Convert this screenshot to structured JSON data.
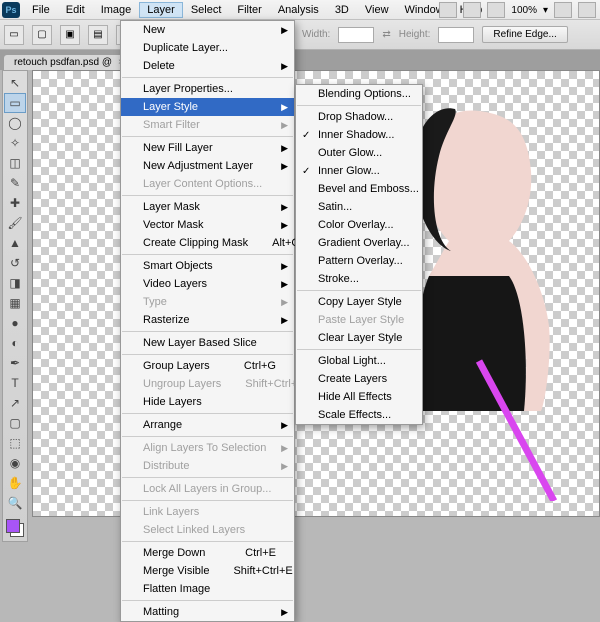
{
  "menubar": {
    "items": [
      "File",
      "Edit",
      "Image",
      "Layer",
      "Select",
      "Filter",
      "Analysis",
      "3D",
      "View",
      "Window",
      "Help"
    ],
    "activeIndex": 3
  },
  "topControls": {
    "zoom": "100%"
  },
  "optionsBar": {
    "widthLabel": "Width:",
    "heightLabel": "Height:",
    "refine": "Refine Edge..."
  },
  "tab": {
    "title": "retouch psdfan.psd @",
    "close": "×"
  },
  "layerMenu": [
    {
      "label": "New",
      "arrow": true
    },
    {
      "label": "Duplicate Layer..."
    },
    {
      "label": "Delete",
      "arrow": true
    },
    {
      "sep": true
    },
    {
      "label": "Layer Properties..."
    },
    {
      "label": "Layer Style",
      "arrow": true,
      "hl": true
    },
    {
      "label": "Smart Filter",
      "arrow": true,
      "disabled": true
    },
    {
      "sep": true
    },
    {
      "label": "New Fill Layer",
      "arrow": true
    },
    {
      "label": "New Adjustment Layer",
      "arrow": true
    },
    {
      "label": "Layer Content Options...",
      "disabled": true
    },
    {
      "sep": true
    },
    {
      "label": "Layer Mask",
      "arrow": true
    },
    {
      "label": "Vector Mask",
      "arrow": true
    },
    {
      "label": "Create Clipping Mask",
      "shortcut": "Alt+Ctrl+G"
    },
    {
      "sep": true
    },
    {
      "label": "Smart Objects",
      "arrow": true
    },
    {
      "label": "Video Layers",
      "arrow": true
    },
    {
      "label": "Type",
      "arrow": true,
      "disabled": true
    },
    {
      "label": "Rasterize",
      "arrow": true
    },
    {
      "sep": true
    },
    {
      "label": "New Layer Based Slice"
    },
    {
      "sep": true
    },
    {
      "label": "Group Layers",
      "shortcut": "Ctrl+G"
    },
    {
      "label": "Ungroup Layers",
      "shortcut": "Shift+Ctrl+G",
      "disabled": true
    },
    {
      "label": "Hide Layers"
    },
    {
      "sep": true
    },
    {
      "label": "Arrange",
      "arrow": true
    },
    {
      "sep": true
    },
    {
      "label": "Align Layers To Selection",
      "arrow": true,
      "disabled": true
    },
    {
      "label": "Distribute",
      "arrow": true,
      "disabled": true
    },
    {
      "sep": true
    },
    {
      "label": "Lock All Layers in Group...",
      "disabled": true
    },
    {
      "sep": true
    },
    {
      "label": "Link Layers",
      "disabled": true
    },
    {
      "label": "Select Linked Layers",
      "disabled": true
    },
    {
      "sep": true
    },
    {
      "label": "Merge Down",
      "shortcut": "Ctrl+E"
    },
    {
      "label": "Merge Visible",
      "shortcut": "Shift+Ctrl+E"
    },
    {
      "label": "Flatten Image"
    },
    {
      "sep": true
    },
    {
      "label": "Matting",
      "arrow": true
    }
  ],
  "styleMenu": [
    {
      "label": "Blending Options..."
    },
    {
      "sep": true
    },
    {
      "label": "Drop Shadow..."
    },
    {
      "label": "Inner Shadow...",
      "check": true
    },
    {
      "label": "Outer Glow..."
    },
    {
      "label": "Inner Glow...",
      "check": true
    },
    {
      "label": "Bevel and Emboss..."
    },
    {
      "label": "Satin..."
    },
    {
      "label": "Color Overlay..."
    },
    {
      "label": "Gradient Overlay..."
    },
    {
      "label": "Pattern Overlay..."
    },
    {
      "label": "Stroke..."
    },
    {
      "sep": true
    },
    {
      "label": "Copy Layer Style"
    },
    {
      "label": "Paste Layer Style",
      "disabled": true
    },
    {
      "label": "Clear Layer Style"
    },
    {
      "sep": true
    },
    {
      "label": "Global Light..."
    },
    {
      "label": "Create Layers"
    },
    {
      "label": "Hide All Effects"
    },
    {
      "label": "Scale Effects..."
    }
  ],
  "tools": [
    {
      "name": "move-tool",
      "glyph": "↖"
    },
    {
      "name": "marquee-tool",
      "glyph": "▭",
      "sel": true
    },
    {
      "name": "lasso-tool",
      "glyph": "◯"
    },
    {
      "name": "wand-tool",
      "glyph": "✧"
    },
    {
      "name": "crop-tool",
      "glyph": "◫"
    },
    {
      "name": "eyedropper-tool",
      "glyph": "✎"
    },
    {
      "name": "healing-tool",
      "glyph": "✚"
    },
    {
      "name": "brush-tool",
      "glyph": "🖌"
    },
    {
      "name": "stamp-tool",
      "glyph": "▲"
    },
    {
      "name": "history-brush-tool",
      "glyph": "↺"
    },
    {
      "name": "eraser-tool",
      "glyph": "◨"
    },
    {
      "name": "gradient-tool",
      "glyph": "▦"
    },
    {
      "name": "blur-tool",
      "glyph": "●"
    },
    {
      "name": "dodge-tool",
      "glyph": "◐"
    },
    {
      "name": "pen-tool",
      "glyph": "✒"
    },
    {
      "name": "type-tool",
      "glyph": "T"
    },
    {
      "name": "path-tool",
      "glyph": "↗"
    },
    {
      "name": "shape-tool",
      "glyph": "▢"
    },
    {
      "name": "3d-tool",
      "glyph": "⬚"
    },
    {
      "name": "camera-tool",
      "glyph": "◉"
    },
    {
      "name": "hand-tool",
      "glyph": "✋"
    },
    {
      "name": "zoom-tool",
      "glyph": "🔍"
    }
  ],
  "colors": {
    "foreground": "#a855f7",
    "background": "#ffffff"
  }
}
